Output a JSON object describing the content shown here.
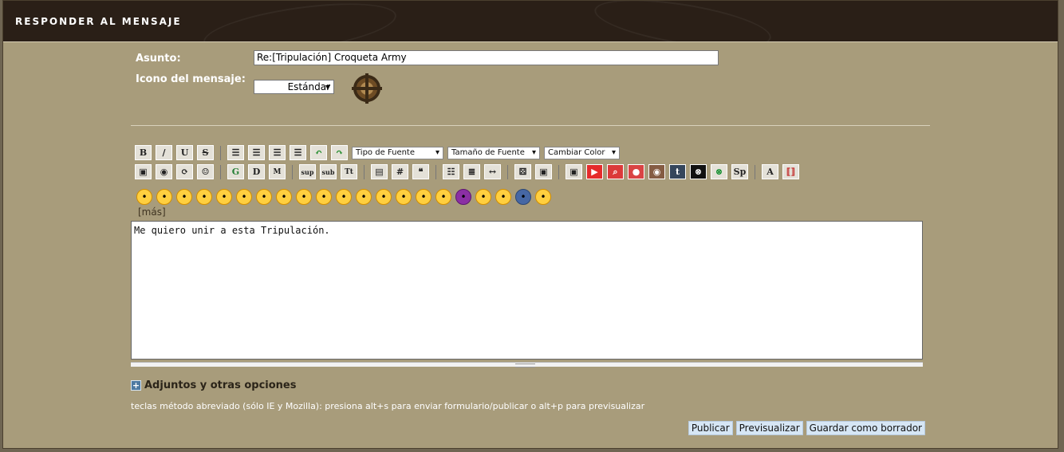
{
  "header": {
    "title": "RESPONDER AL MENSAJE"
  },
  "form": {
    "subject_label": "Asunto:",
    "subject_value": "Re:[Tripulación] Croqueta Army",
    "icon_label": "Icono del mensaje:",
    "icon_value": "Estándar"
  },
  "toolbar": {
    "font_type": "Tipo de Fuente",
    "font_size": "Tamaño de Fuente",
    "font_color": "Cambiar Color",
    "bold": "B",
    "italic": "/",
    "underline": "U",
    "strike": "S",
    "sup": "sup",
    "sub": "sub",
    "tt": "Tt",
    "grid": "#",
    "sp": "Sp"
  },
  "more": "[más]",
  "message": "Me quiero unir a esta Tripulación.",
  "attachments": "Adjuntos y otras opciones",
  "shortcut_note": "teclas método abreviado (sólo IE y Mozilla): presiona alt+s para enviar formulario/publicar o alt+p para previsualizar",
  "buttons": {
    "publish": "Publicar",
    "preview": "Previsualizar",
    "draft": "Guardar como borrador"
  },
  "colors": {
    "panel": "#a89c7b",
    "header": "#2a1f17",
    "button": "#d6e6f5"
  }
}
